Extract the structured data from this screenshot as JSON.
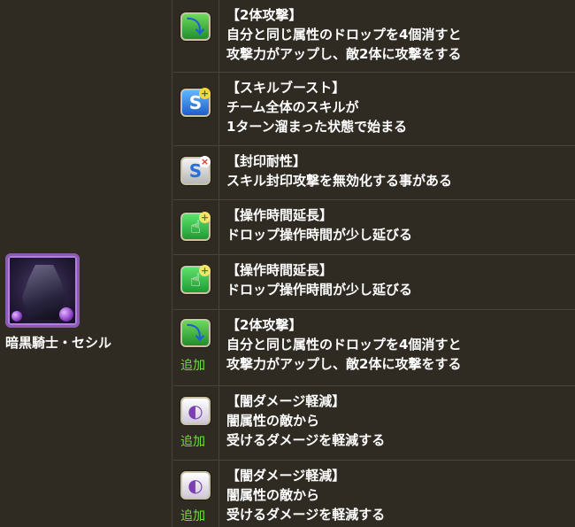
{
  "monster": {
    "name": "暗黒騎士・セシル",
    "attribute_color": "#8a5bb3"
  },
  "colors": {
    "background": "#2f2a22",
    "border": "#4a4438",
    "text": "#ffffff",
    "added_label": "#6fe03a"
  },
  "awakenings": [
    {
      "icon": "two-pronged-attack-icon",
      "title": "【2体攻撃】",
      "lines": [
        "自分と同じ属性のドロップを4個消すと",
        "攻撃力がアップし、敵2体に攻撃をする"
      ],
      "added": ""
    },
    {
      "icon": "skill-boost-icon",
      "title": "【スキルブースト】",
      "lines": [
        "チーム全体のスキルが",
        "1ターン溜まった状態で始まる"
      ],
      "added": ""
    },
    {
      "icon": "skill-bind-resist-icon",
      "title": "【封印耐性】",
      "lines": [
        "スキル封印攻撃を無効化する事がある"
      ],
      "added": ""
    },
    {
      "icon": "time-extend-icon",
      "title": "【操作時間延長】",
      "lines": [
        "ドロップ操作時間が少し延びる"
      ],
      "added": ""
    },
    {
      "icon": "time-extend-icon",
      "title": "【操作時間延長】",
      "lines": [
        "ドロップ操作時間が少し延びる"
      ],
      "added": ""
    },
    {
      "icon": "two-pronged-attack-icon",
      "title": "【2体攻撃】",
      "lines": [
        "自分と同じ属性のドロップを4個消すと",
        "攻撃力がアップし、敵2体に攻撃をする"
      ],
      "added": "追加"
    },
    {
      "icon": "dark-damage-reduction-icon",
      "title": "【闇ダメージ軽減】",
      "lines": [
        "闇属性の敵から",
        "受けるダメージを軽減する"
      ],
      "added": "追加"
    },
    {
      "icon": "dark-damage-reduction-icon",
      "title": "【闇ダメージ軽減】",
      "lines": [
        "闇属性の敵から",
        "受けるダメージを軽減する"
      ],
      "added": "追加"
    }
  ]
}
